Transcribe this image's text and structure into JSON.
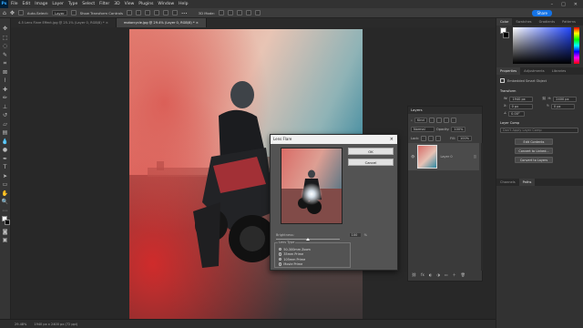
{
  "menubar": {
    "logo": "Ps",
    "items": [
      "File",
      "Edit",
      "Image",
      "Layer",
      "Type",
      "Select",
      "Filter",
      "3D",
      "View",
      "Plugins",
      "Window",
      "Help"
    ],
    "window_controls": [
      "–",
      "□",
      "✕"
    ]
  },
  "options_bar": {
    "auto_select_label": "Auto-Select:",
    "auto_select_value": "Layer",
    "show_transform_label": "Show Transform Controls",
    "mode_3d_label": "3D Mode:",
    "share_label": "Share"
  },
  "tabs": [
    {
      "label": "4-5 Lens Flare Effect.jpg @ 25.1% (Layer 0, RGB/8) *  ×",
      "active": false
    },
    {
      "label": "motorcycle.jpg @ 29.4% (Layer 0, RGB/8) *  ×",
      "active": true
    }
  ],
  "status_bar": {
    "zoom": "29.48%",
    "doc_size": "1940 px x 2400 px (72 ppi)"
  },
  "panels": {
    "color_tabs": [
      "Color",
      "Swatches",
      "Gradients",
      "Patterns"
    ],
    "properties_tabs": [
      "Properties",
      "Adjustments",
      "Libraries"
    ],
    "embedded_label": "Embedded Smart Object",
    "transform_title": "Transform",
    "w_label": "W:",
    "w_value": "1940 px",
    "h_label": "H:",
    "h_value": "2400 px",
    "x_label": "X:",
    "x_value": "0 px",
    "y_label": "Y:",
    "y_value": "0 px",
    "angle_value": "0.00°",
    "layer_comp_label": "Layer Comp",
    "layer_comp_placeholder": "Don't Apply Layer Comp",
    "edit_contents": "Edit Contents",
    "convert_linked": "Convert to Linked...",
    "convert_layers": "Convert to Layers",
    "channels_tabs": [
      "Channels",
      "Paths"
    ]
  },
  "layers": {
    "title": "Layers",
    "kind_label": "Kind",
    "blend_mode": "Normal",
    "opacity_label": "Opacity:",
    "opacity_value": "100%",
    "lock_label": "Lock:",
    "fill_label": "Fill:",
    "fill_value": "100%",
    "layer_name": "Layer 0"
  },
  "dialog": {
    "title": "Lens Flare",
    "ok": "OK",
    "cancel": "Cancel",
    "brightness_label": "Brightness:",
    "brightness_value": "100",
    "brightness_unit": "%",
    "brightness_level": 0.5,
    "lens_type_label": "Lens Type",
    "lens_types": [
      "50-300mm Zoom",
      "35mm Prime",
      "105mm Prime",
      "Movie Prime"
    ],
    "selected_lens": "105mm Prime"
  },
  "colors": {
    "accent": "#1473e6",
    "panel": "#323232"
  }
}
